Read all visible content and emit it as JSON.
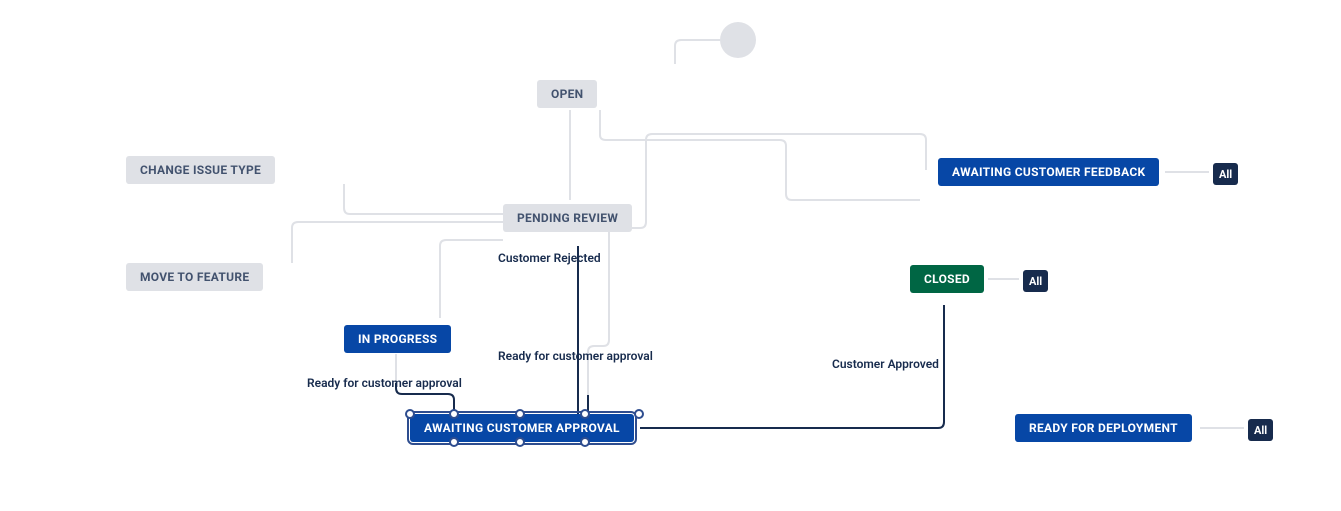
{
  "diagram": {
    "type": "workflow",
    "selected_node": "awaiting_customer_approval",
    "nodes": {
      "open": {
        "label": "OPEN",
        "style": "gray"
      },
      "change_issue_type": {
        "label": "CHANGE ISSUE TYPE",
        "style": "gray"
      },
      "move_to_feature": {
        "label": "MOVE TO FEATURE",
        "style": "gray"
      },
      "pending_review": {
        "label": "PENDING REVIEW",
        "style": "gray"
      },
      "in_progress": {
        "label": "IN PROGRESS",
        "style": "blue"
      },
      "awaiting_customer_approval": {
        "label": "AWAITING CUSTOMER APPROVAL",
        "style": "blue"
      },
      "awaiting_customer_feedback": {
        "label": "AWAITING CUSTOMER FEEDBACK",
        "style": "blue"
      },
      "closed": {
        "label": "CLOSED",
        "style": "green"
      },
      "ready_for_deployment": {
        "label": "READY FOR DEPLOYMENT",
        "style": "blue"
      }
    },
    "transitions": {
      "customer_rejected": {
        "label": "Customer Rejected",
        "from": "awaiting_customer_approval",
        "to": "pending_review"
      },
      "ready_for_customer_approval_1": {
        "label": "Ready for customer approval",
        "from": "in_progress",
        "to": "awaiting_customer_approval"
      },
      "ready_for_customer_approval_2": {
        "label": "Ready for customer approval",
        "from": "pending_review",
        "to": "awaiting_customer_approval"
      },
      "customer_approved": {
        "label": "Customer Approved",
        "from": "awaiting_customer_approval",
        "to": "closed"
      }
    },
    "all_badge": "All"
  }
}
